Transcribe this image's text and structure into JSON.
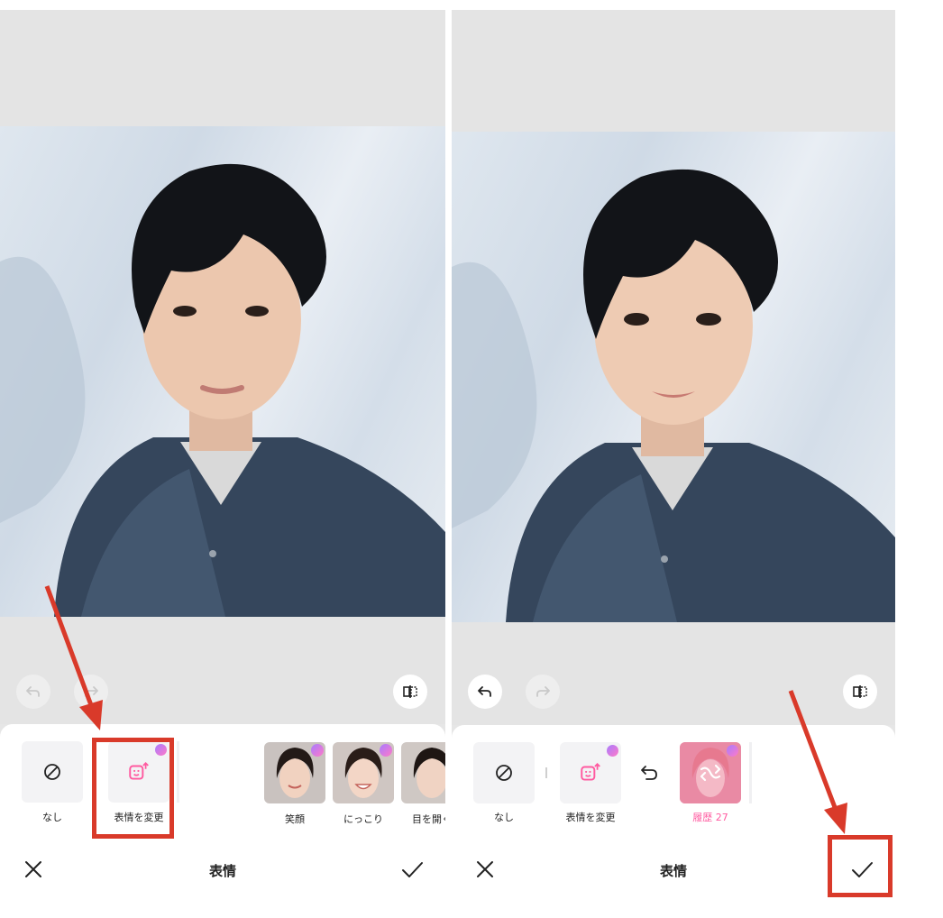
{
  "left": {
    "tiles": [
      {
        "label": "なし",
        "icon": "none-icon"
      },
      {
        "label": "表情を変更",
        "icon": "change-expression-icon"
      }
    ],
    "presets": [
      {
        "label": "笑顔"
      },
      {
        "label": "にっこり"
      },
      {
        "label": "目を開く"
      }
    ],
    "title": "表情"
  },
  "right": {
    "tiles": [
      {
        "label": "なし",
        "icon": "none-icon"
      },
      {
        "label": "表情を変更",
        "icon": "change-expression-icon"
      }
    ],
    "history_label": "履歴 27",
    "title": "表情"
  },
  "colors": {
    "accent_pink": "#ff5aa0",
    "annotation_red": "#d93a2a"
  }
}
